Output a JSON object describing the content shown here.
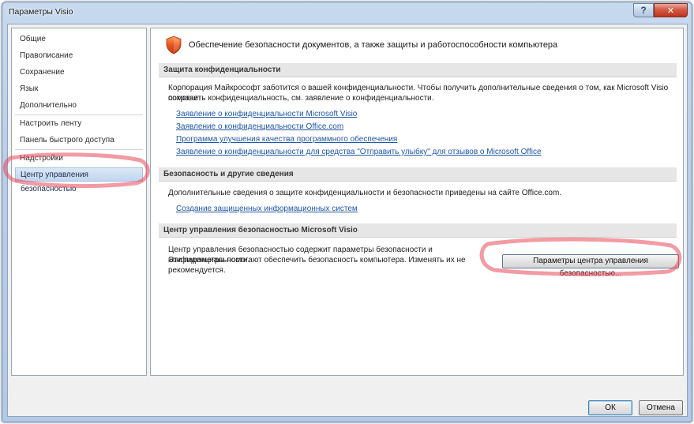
{
  "window": {
    "title": "Параметры Visio",
    "help_glyph": "?",
    "close_glyph": "✕"
  },
  "nav": {
    "items": [
      {
        "label": "Общие"
      },
      {
        "label": "Правописание"
      },
      {
        "label": "Сохранение"
      },
      {
        "label": "Язык"
      },
      {
        "label": "Дополнительно"
      },
      {
        "label": "Настроить ленту"
      },
      {
        "label": "Панель быстрого доступа"
      },
      {
        "label": "Надстройки"
      },
      {
        "label": "Центр управления безопасностью",
        "selected": true
      }
    ]
  },
  "content": {
    "header": "Обеспечение безопасности документов, а также защиты и работоспособности компьютера",
    "shield_icon": "shield-icon",
    "sections": [
      {
        "title": "Защита конфиденциальности",
        "text_line1": "Корпорация Майкрософт заботится о вашей конфиденциальности. Чтобы получить дополнительные сведения о том, как Microsoft Visio помогает",
        "text_line2": "сохранить конфиденциальность, см. заявление о конфиденциальности.",
        "links": [
          "Заявление о конфиденциальности Microsoft Visio",
          "Заявление о конфиденциальности Office.com",
          "Программа улучшения качества программного обеспечения",
          "Заявление о конфиденциальности для средства \"Отправить улыбку\" для отзывов о Microsoft Office"
        ]
      },
      {
        "title": "Безопасность и другие сведения",
        "text": "Дополнительные сведения о защите конфиденциальности и безопасности приведены на сайте Office.com.",
        "links": [
          "Создание защищенных информационных систем"
        ]
      },
      {
        "title": "Центр управления безопасностью Microsoft Visio",
        "text_line1": "Центр управления безопасностью содержит параметры безопасности и конфиденциальности.",
        "text_line2": "Эти параметры помогают обеспечить безопасность компьютера. Изменять их не",
        "text_line3": "рекомендуется.",
        "button_label": "Параметры центра управления безопасностью..."
      }
    ]
  },
  "footer": {
    "ok_label": "ОК",
    "cancel_label": "Отмена"
  },
  "colors": {
    "link": "#1f56a8",
    "annotation": "#e8485a",
    "shield": "#e8541e"
  }
}
